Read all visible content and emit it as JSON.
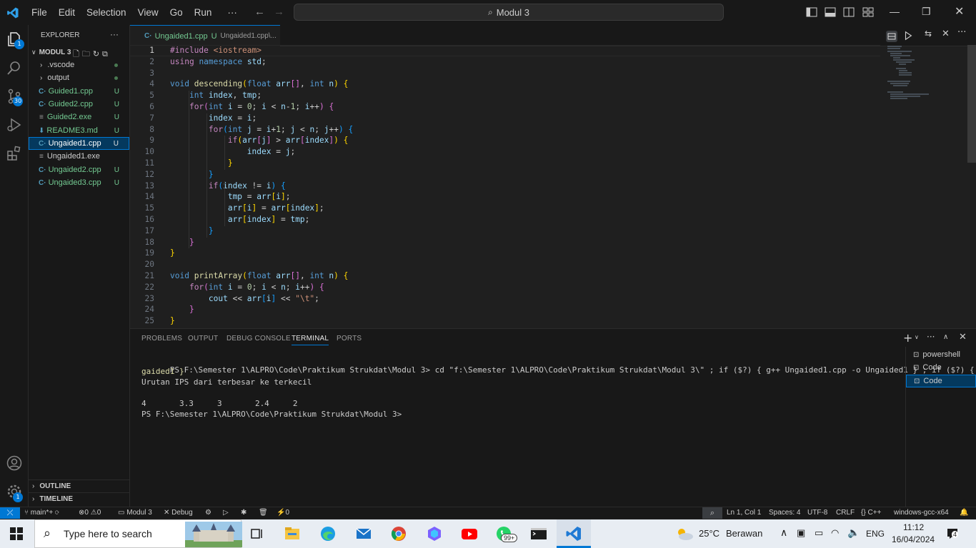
{
  "titlebar": {
    "menu": [
      "File",
      "Edit",
      "Selection",
      "View",
      "Go",
      "Run"
    ],
    "more": "···",
    "command_center": "Modul 3"
  },
  "activity": {
    "explorer_badge": "1",
    "scm_badge": "30",
    "settings_badge": "1"
  },
  "sidebar": {
    "title": "EXPLORER",
    "more": "···",
    "folder": "MODUL 3",
    "items": [
      {
        "label": ".vscode",
        "kind": "folder",
        "status": ""
      },
      {
        "label": "output",
        "kind": "folder",
        "status": ""
      },
      {
        "label": "Guided1.cpp",
        "kind": "cpp",
        "status": "U"
      },
      {
        "label": "Guided2.cpp",
        "kind": "cpp",
        "status": "U"
      },
      {
        "label": "Guided2.exe",
        "kind": "exe",
        "status": "U"
      },
      {
        "label": "README3.md",
        "kind": "md",
        "status": "U"
      },
      {
        "label": "Ungaided1.cpp",
        "kind": "cpp",
        "status": "U"
      },
      {
        "label": "Ungaided1.exe",
        "kind": "exe",
        "status": ""
      },
      {
        "label": "Ungaided2.cpp",
        "kind": "cpp",
        "status": "U"
      },
      {
        "label": "Ungaided3.cpp",
        "kind": "cpp",
        "status": "U"
      }
    ],
    "outline": "OUTLINE",
    "timeline": "TIMELINE"
  },
  "editor": {
    "tab_name": "Ungaided1.cpp",
    "tab_status": "U",
    "tab_path": "Ungaided1.cpp\\...",
    "line_numbers": [
      "1",
      "2",
      "3",
      "4",
      "5",
      "6",
      "7",
      "8",
      "9",
      "10",
      "11",
      "12",
      "13",
      "14",
      "15",
      "16",
      "17",
      "18",
      "19",
      "20",
      "21",
      "22",
      "23",
      "24",
      "25"
    ]
  },
  "panel": {
    "tabs": [
      "PROBLEMS",
      "OUTPUT",
      "DEBUG CONSOLE",
      "TERMINAL",
      "PORTS"
    ],
    "active_tab": "TERMINAL",
    "terminal_lines": [
      "PS F:\\Semester 1\\ALPRO\\Code\\Praktikum Strukdat\\Modul 3> cd \"f:\\Semester 1\\ALPRO\\Code\\Praktikum Strukdat\\Modul 3\\\" ; if ($?) { g++ Ungaided1.cpp -o Ungaided1 } ; if ($?) { .\\Un",
      "gaided1 }",
      "Urutan IPS dari terbesar ke terkecil",
      "",
      "4       3.3     3       2.4     2",
      "PS F:\\Semester 1\\ALPRO\\Code\\Praktikum Strukdat\\Modul 3> "
    ],
    "terminals": [
      "powershell",
      "Code",
      "Code"
    ]
  },
  "statusbar": {
    "branch": "main*+",
    "errors": "0",
    "warnings": "0",
    "folder": "Modul 3",
    "debug": "Debug",
    "ports": "0",
    "position": "Ln 1, Col 1",
    "spaces": "Spaces: 4",
    "encoding": "UTF-8",
    "eol": "CRLF",
    "language": "C++",
    "config": "windows-gcc-x64"
  },
  "taskbar": {
    "search_placeholder": "Type here to search",
    "whatsapp_badge": "99+",
    "weather_temp": "25°C",
    "weather_text": "Berawan",
    "lang": "ENG",
    "time": "11:12",
    "date": "16/04/2024",
    "notif_count": "4"
  },
  "colors": {
    "accent": "#0078d4",
    "untracked": "#73c991",
    "keyword": "#569cd6",
    "function": "#dcdcaa",
    "variable": "#9cdcfe",
    "string": "#ce9178"
  }
}
